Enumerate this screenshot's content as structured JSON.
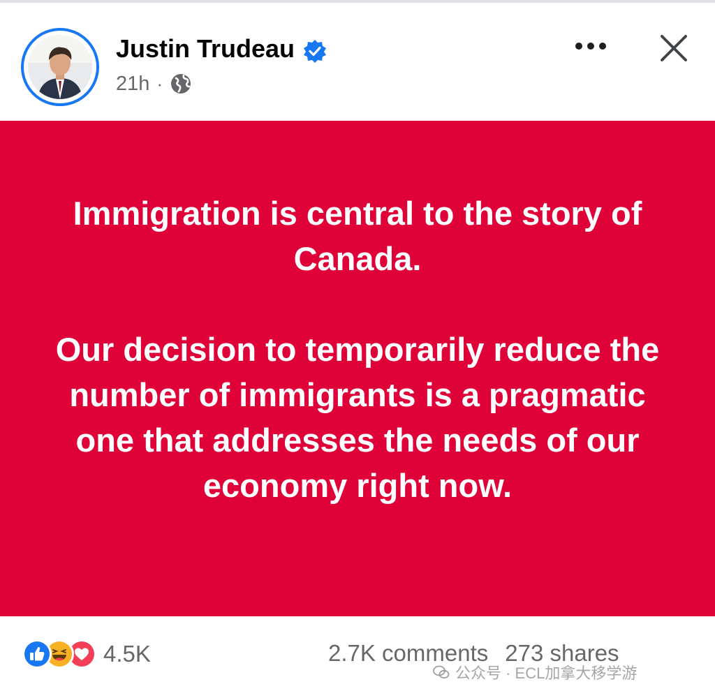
{
  "post": {
    "author_name": "Justin Trudeau",
    "time": "21h",
    "separator": "·",
    "privacy_icon": "globe-icon",
    "verified_icon": "verified-badge-icon",
    "menu_icon": "more-horizontal-icon",
    "close_icon": "close-icon",
    "background_color": "#df0238",
    "paragraphs": [
      "Immigration is central to the story of Canada.",
      "Our decision to temporarily reduce the number of immigrants is a pragmatic one that addresses the needs of our economy right now."
    ]
  },
  "footer": {
    "reaction_icons": [
      "like-icon",
      "haha-icon",
      "love-icon"
    ],
    "reaction_count": "4.5K",
    "comments": "2.7K comments",
    "shares": "273 shares"
  },
  "watermark": {
    "text": "公众号 · ECL加拿大移学游"
  },
  "colors": {
    "accent": "#1877f2",
    "text_primary": "#050505",
    "text_secondary": "#65676b",
    "like": "#1877f2",
    "haha": "#f7b125",
    "love": "#f33e58"
  }
}
